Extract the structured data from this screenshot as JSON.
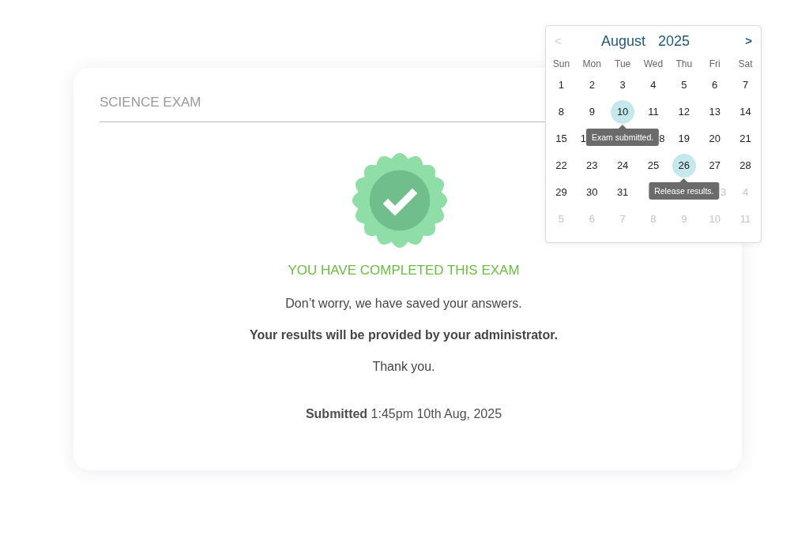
{
  "exam": {
    "title": "SCIENCE EXAM"
  },
  "completion": {
    "heading": "YOU HAVE COMPLETED THIS EXAM",
    "lines": [
      {
        "text": "Don’t worry, we have saved your answers.",
        "bold": false
      },
      {
        "text": "Your results will be provided by your administrator.",
        "bold": true
      },
      {
        "text": "Thank you.",
        "bold": false
      }
    ],
    "submitted": "**Submitted** 1:45pm 10th Aug, 2025"
  },
  "calendar": {
    "prev": "<",
    "prev_disabled": true,
    "month": "August",
    "year": "2025",
    "next": ">",
    "next_disabled": false,
    "weekdays": [
      "Sun",
      "Mon",
      "Tue",
      "Wed",
      "Thu",
      "Fri",
      "Sat"
    ],
    "weeks": [
      {
        "days": [
          {
            "label": "1",
            "kind": "day",
            "highlighted": false
          },
          {
            "label": "2",
            "kind": "day",
            "highlighted": false
          },
          {
            "label": "3",
            "kind": "day",
            "highlighted": false
          },
          {
            "label": "4",
            "kind": "day",
            "highlighted": false
          },
          {
            "label": "5",
            "kind": "day",
            "highlighted": false
          },
          {
            "label": "6",
            "kind": "day",
            "highlighted": false
          },
          {
            "label": "7",
            "kind": "day",
            "highlighted": false
          }
        ]
      },
      {
        "days": [
          {
            "label": "8",
            "kind": "day",
            "highlighted": false
          },
          {
            "label": "9",
            "kind": "day",
            "highlighted": false
          },
          {
            "label": "10",
            "kind": "day",
            "highlighted": true,
            "tooltip": "Exam submitted."
          },
          {
            "label": "11",
            "kind": "day",
            "highlighted": false
          },
          {
            "label": "12",
            "kind": "day",
            "highlighted": false
          },
          {
            "label": "13",
            "kind": "day",
            "highlighted": false
          },
          {
            "label": "14",
            "kind": "day",
            "highlighted": false
          }
        ]
      },
      {
        "days": [
          {
            "label": "15",
            "kind": "day",
            "highlighted": false
          },
          {
            "label": "1",
            "kind": "day",
            "highlighted": false,
            "covered_right": true
          },
          {
            "kind": "covered"
          },
          {
            "label": "8",
            "kind": "day",
            "highlighted": false,
            "covered_left": true
          },
          {
            "label": "19",
            "kind": "day",
            "highlighted": false
          },
          {
            "label": "20",
            "kind": "day",
            "highlighted": false
          },
          {
            "label": "21",
            "kind": "day",
            "highlighted": false
          }
        ]
      },
      {
        "days": [
          {
            "label": "22",
            "kind": "day",
            "highlighted": false
          },
          {
            "label": "23",
            "kind": "day",
            "highlighted": false
          },
          {
            "label": "24",
            "kind": "day",
            "highlighted": false
          },
          {
            "label": "25",
            "kind": "day",
            "highlighted": false
          },
          {
            "label": "26",
            "kind": "day",
            "highlighted": true,
            "tooltip": "Release results."
          },
          {
            "label": "27",
            "kind": "day",
            "highlighted": false
          },
          {
            "label": "28",
            "kind": "day",
            "highlighted": false
          }
        ]
      },
      {
        "days": [
          {
            "label": "29",
            "kind": "day",
            "highlighted": false
          },
          {
            "label": "30",
            "kind": "day",
            "highlighted": false
          },
          {
            "label": "31",
            "kind": "day",
            "highlighted": false
          },
          {
            "kind": "covered"
          },
          {
            "kind": "covered"
          },
          {
            "label": "3",
            "kind": "outside",
            "highlighted": false,
            "covered_left": true
          },
          {
            "label": "4",
            "kind": "outside",
            "highlighted": false
          }
        ]
      },
      {
        "days": [
          {
            "label": "5",
            "kind": "outside",
            "highlighted": false
          },
          {
            "label": "6",
            "kind": "outside",
            "highlighted": false
          },
          {
            "label": "7",
            "kind": "outside",
            "highlighted": false
          },
          {
            "label": "8",
            "kind": "outside",
            "highlighted": false
          },
          {
            "label": "9",
            "kind": "outside",
            "highlighted": false
          },
          {
            "label": "10",
            "kind": "outside",
            "highlighted": false
          },
          {
            "label": "11",
            "kind": "outside",
            "highlighted": false
          }
        ]
      }
    ]
  }
}
